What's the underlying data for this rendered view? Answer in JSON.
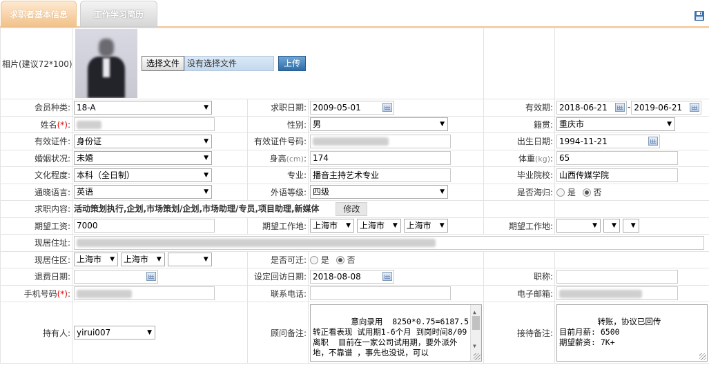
{
  "tabs": [
    {
      "label": "求职者基本信息",
      "active": true
    },
    {
      "label": "工作学习简历",
      "active": false
    }
  ],
  "icons": {
    "save": "save-icon",
    "calendar": "calendar-icon",
    "dropdown": "chevron-down-icon"
  },
  "photo": {
    "label": "相片(建议72*100):",
    "choose_button": "选择文件",
    "file_status": "没有选择文件",
    "upload_button": "上传"
  },
  "fields": {
    "member_type": {
      "label": "会员种类:",
      "value": "18-A"
    },
    "job_date": {
      "label": "求职日期:",
      "value": "2009-05-01"
    },
    "valid_period": {
      "label": "有效期:",
      "from": "2018-06-21",
      "sep": "-",
      "to": "2019-06-21"
    },
    "name": {
      "label": "姓名",
      "req": "(*)",
      "colon": ":"
    },
    "gender": {
      "label": "性别:",
      "value": "男"
    },
    "native_place": {
      "label": "籍贯:",
      "value": "重庆市"
    },
    "id_type": {
      "label": "有效证件:",
      "value": "身份证"
    },
    "id_number": {
      "label": "有效证件号码:"
    },
    "birth_date": {
      "label": "出生日期:",
      "value": "1994-11-21"
    },
    "marital": {
      "label": "婚姻状况:",
      "value": "未婚"
    },
    "height": {
      "label": "身高",
      "unit": "(cm)",
      "colon": ":",
      "value": "174"
    },
    "weight": {
      "label": "体重",
      "unit": "(kg)",
      "colon": ":",
      "value": "65"
    },
    "education": {
      "label": "文化程度:",
      "value": "本科（全日制）"
    },
    "major": {
      "label": "专业:",
      "value": "播音主持艺术专业"
    },
    "school": {
      "label": "毕业院校:",
      "value": "山西传媒学院"
    },
    "language": {
      "label": "通晓语言:",
      "value": "英语"
    },
    "language_level": {
      "label": "外语等级:",
      "value": "四级"
    },
    "overseas": {
      "label": "是否海归:",
      "yes": "是",
      "no": "否",
      "selected": "否"
    },
    "job_content": {
      "label": "求职内容:",
      "value": "活动策划执行,企划,市场策划/企划,市场助理/专员,项目助理,新媒体",
      "edit_button": "修改"
    },
    "expected_salary": {
      "label": "期望工资:",
      "value": "7000"
    },
    "expected_location_1": {
      "label": "期望工作地:",
      "province": "上海市",
      "city": "上海市",
      "district": "上海市"
    },
    "expected_location_2": {
      "label": "期望工作地:"
    },
    "address": {
      "label": "现居住址:"
    },
    "district": {
      "label": "现居住区:",
      "province": "上海市",
      "city": "上海市"
    },
    "relocate": {
      "label": "是否可迁:",
      "yes": "是",
      "no": "否",
      "selected": "否"
    },
    "refund_date": {
      "label": "退费日期:"
    },
    "callback_date": {
      "label": "设定回访日期:",
      "value": "2018-08-08"
    },
    "title": {
      "label": "职称:"
    },
    "mobile": {
      "label": "手机号码",
      "req": "(*)",
      "colon": ":"
    },
    "phone": {
      "label": "联系电话:"
    },
    "email": {
      "label": "电子邮箱:"
    },
    "owner": {
      "label": "持有人:",
      "value": "yirui007"
    },
    "advisor_note": {
      "label": "顾问备注:",
      "value": "意向录用  8250*0.75=6187.5\n转正看表现 试用期1-6个月 到岗时间8/09\n离职  目前在一家公司试用期，要外派外地，不靠谱 ，事先也没说，可以"
    },
    "reception_note": {
      "label": "接待备注:",
      "value": "转账，协议已回传\n目前月薪: 6500\n期望薪资: 7K+"
    }
  }
}
